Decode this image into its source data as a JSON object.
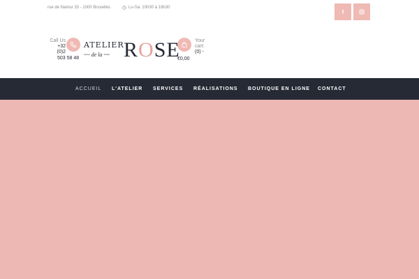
{
  "topbar": {
    "address": "rue de Namur 33 - 1000 Bruxelles",
    "hours": "Lu-Sa: 10h30 à 18h30",
    "social": [
      {
        "name": "facebook",
        "glyph": "f"
      },
      {
        "name": "instagram",
        "glyph": "◎"
      }
    ]
  },
  "header": {
    "call_label": "Call Us",
    "phone_lines": [
      "+32",
      "(0)2",
      "503 58 48"
    ],
    "logo_line1": "ATELIER",
    "logo_line2": "~~ de la ~~",
    "logo_big_pre": "R",
    "logo_big_o": "O",
    "logo_big_post": "SE",
    "cart_label_1": "Your",
    "cart_label_2": "cart:",
    "cart_count": "(0) -",
    "cart_total": "€0,00",
    "accent_color": "#efb9b4",
    "dark_color": "#262a35"
  },
  "nav": {
    "items": [
      {
        "label": "ACCUEIL",
        "active": true
      },
      {
        "label": "L'ATELIER",
        "active": false
      },
      {
        "label": "SERVICES",
        "active": false
      },
      {
        "label": "RÉALISATIONS",
        "active": false
      },
      {
        "label": "BOUTIQUE EN LIGNE",
        "active": false
      },
      {
        "label": "CONTACT",
        "active": false
      }
    ]
  },
  "hero": {
    "background_color": "#edb8b3"
  }
}
